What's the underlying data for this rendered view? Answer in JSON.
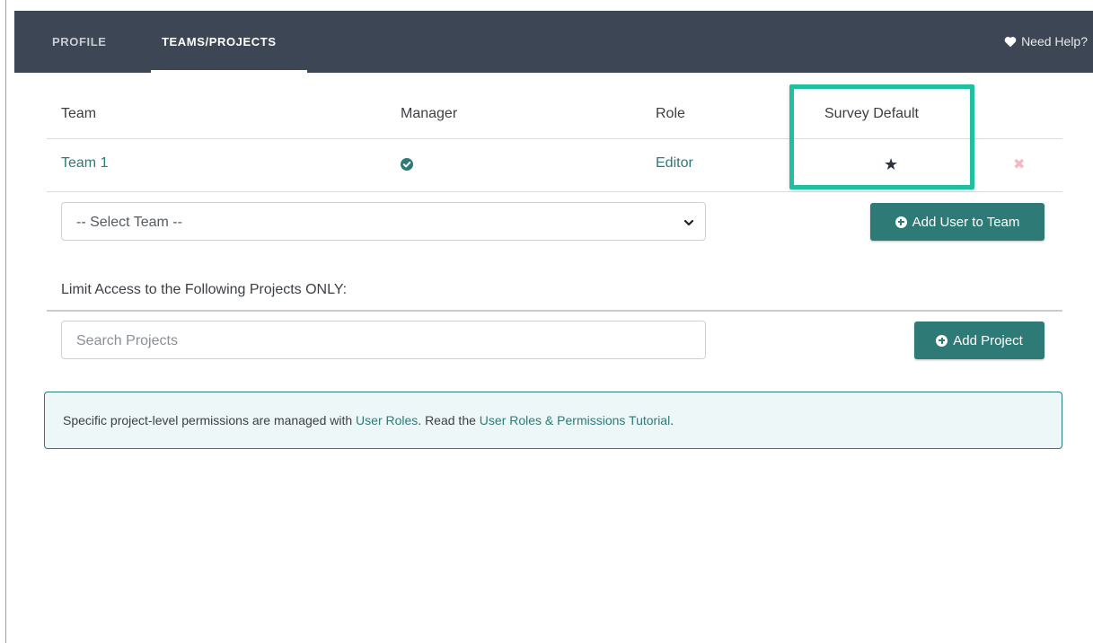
{
  "nav": {
    "tabs": [
      {
        "label": "PROFILE",
        "active": false
      },
      {
        "label": "TEAMS/PROJECTS",
        "active": true
      }
    ],
    "help": {
      "icon": "heart-icon",
      "label": "Need Help?"
    }
  },
  "teams_table": {
    "headers": [
      "Team",
      "Manager",
      "Role",
      "Survey Default"
    ],
    "rows": [
      {
        "team": "Team 1",
        "manager_icon": "check-circle-icon",
        "role": "Editor",
        "default_icon": "star-icon",
        "remove_icon": "close-icon"
      }
    ]
  },
  "team_select": {
    "value": "-- Select Team --"
  },
  "add_user_button": {
    "label": "Add User to Team",
    "icon": "plus-circle-icon"
  },
  "projects": {
    "label": "Limit Access to the Following Projects ONLY:",
    "search_placeholder": "Search Projects",
    "add_button": {
      "label": "Add Project",
      "icon": "plus-circle-icon"
    }
  },
  "info": {
    "text_1": "Specific project-level permissions are managed with ",
    "link_1": "User Roles",
    "text_2": ". Read the ",
    "link_2": "User Roles & Permissions Tutorial",
    "text_3": "."
  },
  "colors": {
    "topbar": "#3d4654",
    "accent": "#2e7a77",
    "highlight": "#1fbf9f",
    "remove": "#f3b8c0"
  }
}
